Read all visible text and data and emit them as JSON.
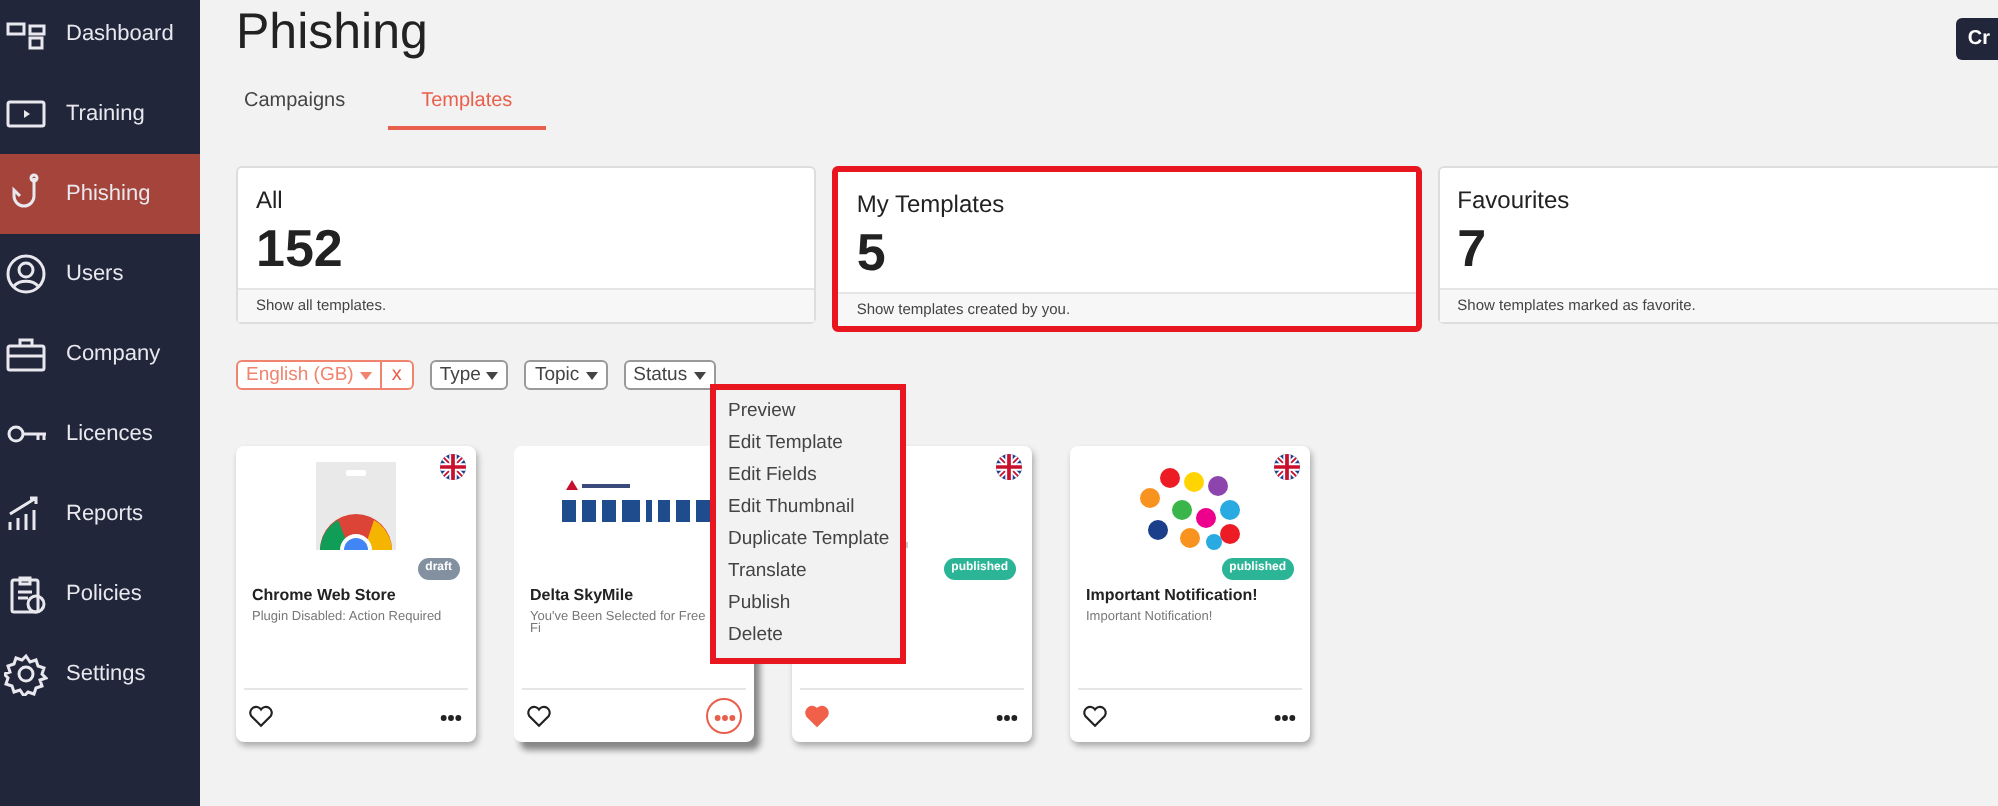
{
  "sidebar": {
    "items": [
      {
        "label": "Dashboard",
        "selected": false
      },
      {
        "label": "Training",
        "selected": false
      },
      {
        "label": "Phishing",
        "selected": true
      },
      {
        "label": "Users",
        "selected": false
      },
      {
        "label": "Company",
        "selected": false
      },
      {
        "label": "Licences",
        "selected": false
      },
      {
        "label": "Reports",
        "selected": false
      },
      {
        "label": "Policies",
        "selected": false
      },
      {
        "label": "Settings",
        "selected": false
      }
    ]
  },
  "page": {
    "title": "Phishing",
    "action_button": "Cr"
  },
  "tabs": [
    {
      "label": "Campaigns",
      "selected": false
    },
    {
      "label": "Templates",
      "selected": true
    }
  ],
  "stats": [
    {
      "label": "All",
      "value": "152",
      "footer": "Show all templates.",
      "highlighted": false
    },
    {
      "label": "My Templates",
      "value": "5",
      "footer": "Show templates created by you.",
      "highlighted": true
    },
    {
      "label": "Favourites",
      "value": "7",
      "footer": "Show templates marked as favorite.",
      "highlighted": false
    }
  ],
  "filters": [
    {
      "label": "English (GB)",
      "active": true,
      "clear": "x"
    },
    {
      "label": "Type",
      "active": false
    },
    {
      "label": "Topic",
      "active": false
    },
    {
      "label": "Status",
      "active": false
    }
  ],
  "templates": [
    {
      "title": "Chrome Web Store",
      "subtitle": "Plugin Disabled: Action Required",
      "status": "draft",
      "flag": true,
      "favourite": false,
      "menu_open": false
    },
    {
      "title": "Delta SkyMile",
      "subtitle": "You've Been Selected for Free\nFi",
      "favourite": false,
      "menu_open": true
    },
    {
      "status": "published",
      "flag": true,
      "favourite": true,
      "menu_open": false
    },
    {
      "title": "Important Notification!",
      "subtitle": "Important Notification!",
      "status": "published",
      "flag": true,
      "favourite": false,
      "menu_open": false
    }
  ],
  "context_menu": {
    "highlighted": true,
    "items": [
      "Preview",
      "Edit Template",
      "Edit Fields",
      "Edit Thumbnail",
      "Duplicate Template",
      "Translate",
      "Publish",
      "Delete"
    ]
  }
}
